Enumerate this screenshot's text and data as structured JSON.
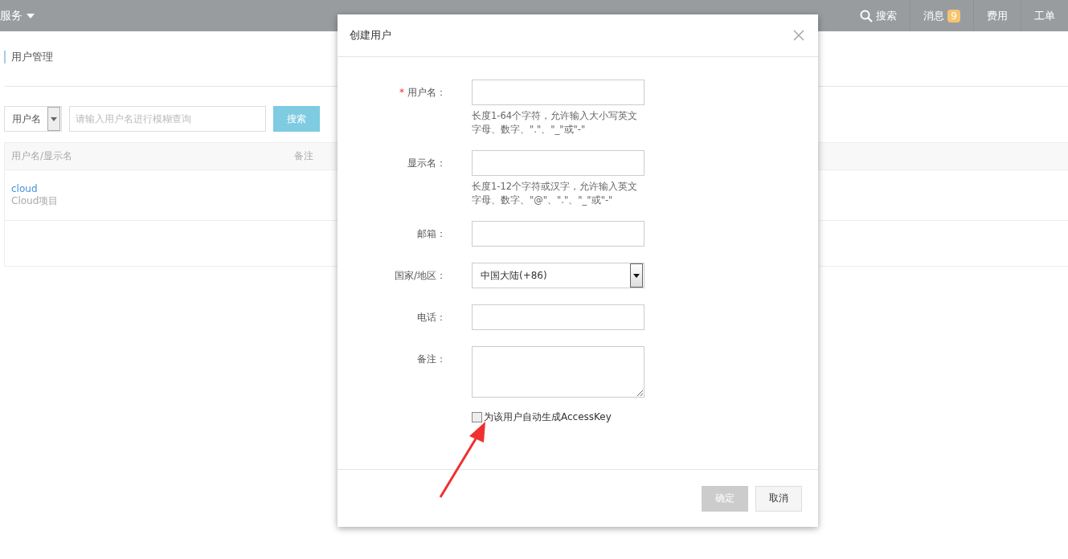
{
  "top_bar": {
    "menu": "服务",
    "nav": [
      {
        "label": "搜索",
        "kind": "search"
      },
      {
        "label": "消息",
        "kind": "badge",
        "badge": "9"
      },
      {
        "label": "费用",
        "kind": "plain"
      },
      {
        "label": "工单",
        "kind": "plain"
      }
    ]
  },
  "page": {
    "title": "用户管理",
    "search": {
      "filter": "用户名",
      "placeholder": "请输入用户名进行模糊查询",
      "button": "搜索"
    },
    "table": {
      "columns": [
        "用户名/显示名",
        "备注"
      ],
      "rows": [
        {
          "name": "cloud",
          "display_name": "Cloud项目"
        }
      ]
    }
  },
  "dialog": {
    "title": "创建用户",
    "fields": [
      {
        "label": "用户名：",
        "required_mark": "*",
        "kind": "text",
        "hint": "长度1-64个字符，允许输入大小写英文字母、数字、\".\"、\"_\"或\"-\""
      },
      {
        "label": "显示名：",
        "kind": "text",
        "hint": "长度1-12个字符或汉字，允许输入英文字母、数字、\"@\"、\".\"、\"_\"或\"-\""
      },
      {
        "label": "邮箱：",
        "kind": "text"
      },
      {
        "label": "国家/地区：",
        "kind": "select",
        "value": "中国大陆(+86)"
      },
      {
        "label": "电话：",
        "kind": "text"
      },
      {
        "label": "备注：",
        "kind": "textarea"
      }
    ],
    "checkbox": {
      "label": "为该用户自动生成AccessKey",
      "checked": false
    },
    "buttons": [
      {
        "label": "确定",
        "disabled": true
      },
      {
        "label": "取消",
        "disabled": false
      }
    ]
  }
}
